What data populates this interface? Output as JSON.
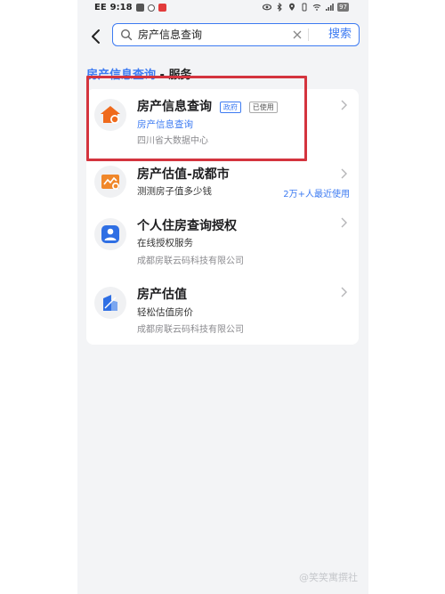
{
  "status_bar": {
    "carrier": "EE",
    "time": "9:18",
    "battery": "97"
  },
  "search": {
    "query": "房产信息查询",
    "button_label": "搜索"
  },
  "section": {
    "title": "房产信息查询",
    "suffix": " - 服务"
  },
  "results": [
    {
      "title": "房产信息查询",
      "tags": [
        "政府",
        "已使用"
      ],
      "subtitle": "房产信息查询",
      "provider": "四川省大数据中心",
      "icon": "house-icon",
      "icon_color": "#ef6a1c"
    },
    {
      "title": "房产估值-成都市",
      "subtitle": "测测房子值多少钱",
      "users": "2万+人最近使用",
      "icon": "house-valuation-icon",
      "icon_color": "#f0872a"
    },
    {
      "title": "个人住房查询授权",
      "subtitle": "在线授权服务",
      "provider": "成都房联云码科技有限公司",
      "icon": "person-authorize-icon",
      "icon_color": "#2f6fe4"
    },
    {
      "title": "房产估值",
      "subtitle": "轻松估值房价",
      "provider": "成都房联云码科技有限公司",
      "icon": "building-valuation-icon",
      "icon_color": "#2f6fe4"
    }
  ],
  "watermark": "@笑笑寓撰社",
  "colors": {
    "accent": "#3d7bf2",
    "highlight": "#d4343e"
  }
}
